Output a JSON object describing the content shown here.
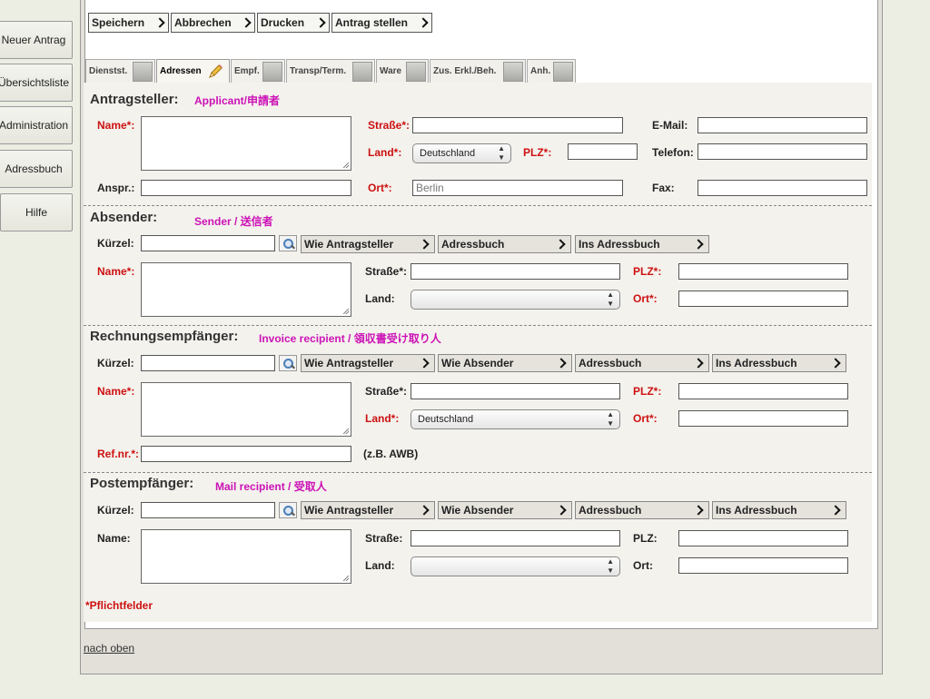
{
  "sidebar": {
    "items": [
      {
        "label": "Neuer Antrag"
      },
      {
        "label": "Übersichtsliste"
      },
      {
        "label": "Administration"
      },
      {
        "label": "Adressbuch"
      },
      {
        "label": "Hilfe"
      }
    ]
  },
  "toolbar": {
    "save": "Speichern",
    "cancel": "Abbrechen",
    "print": "Drucken",
    "submit": "Antrag stellen"
  },
  "tabs": [
    {
      "label": "Dienstst."
    },
    {
      "label": "Adressen",
      "active": true
    },
    {
      "label": "Empf."
    },
    {
      "label": "Transp/Term."
    },
    {
      "label": "Ware"
    },
    {
      "label": "Zus. Erkl./Beh."
    },
    {
      "label": "Anh."
    }
  ],
  "applicant": {
    "title": "Antragsteller:",
    "annotation": "Applicant/申請者",
    "name_label": "Name*:",
    "street_label": "Straße*:",
    "email_label": "E-Mail:",
    "country_label": "Land*:",
    "country_value": "Deutschland",
    "zip_label": "PLZ*:",
    "phone_label": "Telefon:",
    "contact_label": "Anspr.:",
    "city_label": "Ort*:",
    "city_value": "Berlin",
    "fax_label": "Fax:"
  },
  "sender": {
    "title": "Absender:",
    "annotation": "Sender / 送信者",
    "short_label": "Kürzel:",
    "btn_like_applicant": "Wie Antragsteller",
    "btn_addressbook": "Adressbuch",
    "btn_to_addressbook": "Ins Adressbuch",
    "name_label": "Name*:",
    "street_label": "Straße*:",
    "zip_label": "PLZ*:",
    "country_label": "Land:",
    "city_label": "Ort*:"
  },
  "invoice": {
    "title": "Rechnungsempfänger:",
    "annotation": "Invoice recipient / 領収書受け取り人",
    "short_label": "Kürzel:",
    "btn_like_applicant": "Wie Antragsteller",
    "btn_like_sender": "Wie Absender",
    "btn_addressbook": "Adressbuch",
    "btn_to_addressbook": "Ins Adressbuch",
    "name_label": "Name*:",
    "street_label": "Straße*:",
    "zip_label": "PLZ*:",
    "country_label": "Land*:",
    "country_value": "Deutschland",
    "city_label": "Ort*:",
    "ref_label": "Ref.nr.*:",
    "ref_hint": "(z.B. AWB)"
  },
  "mail": {
    "title": "Postempfänger:",
    "annotation": "Mail recipient / 受取人",
    "short_label": "Kürzel:",
    "btn_like_applicant": "Wie Antragsteller",
    "btn_like_sender": "Wie Absender",
    "btn_addressbook": "Adressbuch",
    "btn_to_addressbook": "Ins Adressbuch",
    "name_label": "Name:",
    "street_label": "Straße:",
    "zip_label": "PLZ:",
    "country_label": "Land:",
    "city_label": "Ort:"
  },
  "footer": {
    "required_note": "*Pflichtfelder",
    "back_to_top": "nach oben"
  }
}
